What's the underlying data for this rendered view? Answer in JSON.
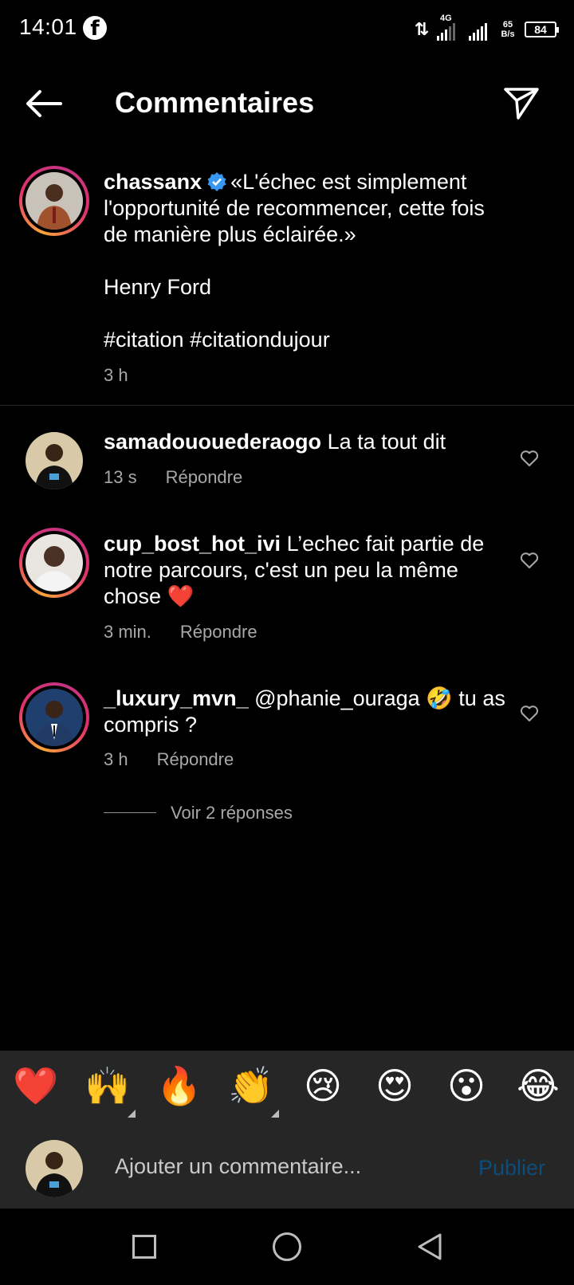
{
  "status_bar": {
    "time": "14:01",
    "network": "4G",
    "speed_top": "65",
    "speed_bottom": "B/s",
    "battery": "84"
  },
  "header": {
    "title": "Commentaires",
    "back_icon": "arrow-left-icon",
    "share_icon": "paper-plane-icon"
  },
  "post": {
    "username": "chassanx",
    "verified": true,
    "caption_lines": [
      "«L'échec est simplement",
      "l'opportunité de recommencer, cette fois",
      "de manière plus éclairée.»"
    ],
    "author": "Henry Ford",
    "hashtags": "#citation #citationdujour",
    "time": "3 h"
  },
  "comments": [
    {
      "username": "samadououederaogo",
      "text_line1": "La ta tout dit",
      "text_line2": "",
      "text_line3": "",
      "time": "13 s",
      "reply_label": "Répondre"
    },
    {
      "username": "cup_bost_hot_ivi",
      "text_line1": "L’echec fait partie de",
      "text_line2": "notre parcours, c'est un peu la même",
      "text_line3": "chose ❤️",
      "time": "3 min.",
      "reply_label": "Répondre"
    },
    {
      "username": "_luxury_mvn_",
      "text_line1": "@phanie_ouraga 🤣 tu as",
      "text_line2": "compris ?",
      "text_line3": "",
      "time": "3 h",
      "reply_label": "Répondre"
    }
  ],
  "view_replies": "Voir 2 réponses",
  "emoji_bar": [
    "❤️",
    "🙌",
    "🔥",
    "👏",
    "😢",
    "😍",
    "😮",
    "😂"
  ],
  "input": {
    "placeholder": "Ajouter un commentaire...",
    "publish_label": "Publier"
  },
  "colors": {
    "background": "#000000",
    "secondary_text": "#a8a8a8",
    "panel": "#262626",
    "publish_disabled": "#0d4d7a",
    "verified": "#3897f0"
  }
}
